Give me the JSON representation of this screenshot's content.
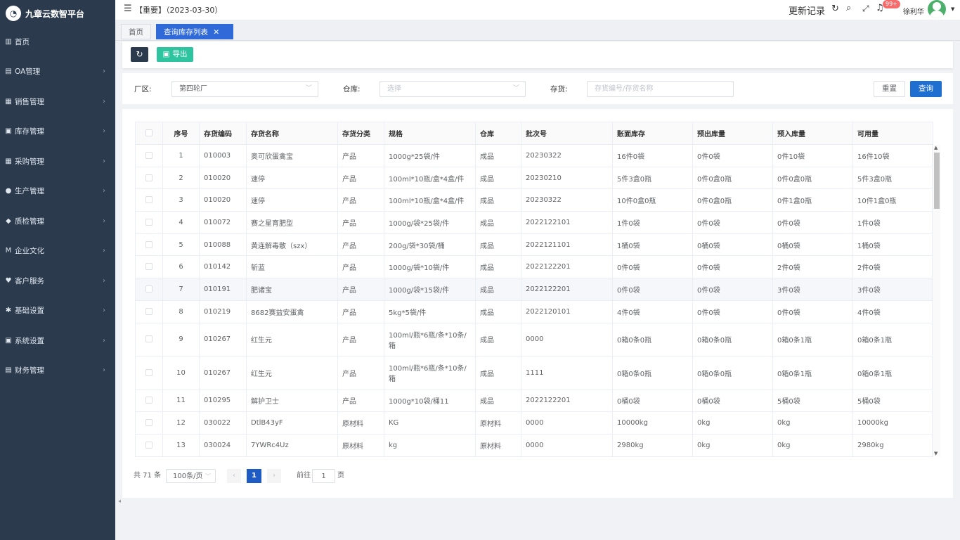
{
  "app": {
    "name": "九章云数智平台"
  },
  "sidebar": {
    "items": [
      {
        "label": "首页",
        "icon": "home-icon",
        "glyph": "▥"
      },
      {
        "label": "OA管理",
        "icon": "oa-icon",
        "glyph": "▤"
      },
      {
        "label": "销售管理",
        "icon": "sales-icon",
        "glyph": "▦"
      },
      {
        "label": "库存管理",
        "icon": "inventory-icon",
        "glyph": "▣"
      },
      {
        "label": "采购管理",
        "icon": "purchase-icon",
        "glyph": "▦"
      },
      {
        "label": "生产管理",
        "icon": "production-icon",
        "glyph": "●"
      },
      {
        "label": "质检管理",
        "icon": "quality-icon",
        "glyph": "◆"
      },
      {
        "label": "企业文化",
        "icon": "culture-icon",
        "glyph": "M"
      },
      {
        "label": "客户服务",
        "icon": "service-icon",
        "glyph": "♥"
      },
      {
        "label": "基础设置",
        "icon": "basic-settings-icon",
        "glyph": "✱"
      },
      {
        "label": "系统设置",
        "icon": "system-settings-icon",
        "glyph": "▣"
      },
      {
        "label": "财务管理",
        "icon": "finance-icon",
        "glyph": "▤"
      }
    ]
  },
  "topbar": {
    "notice": "【重要】（2023-03-30）",
    "update_log": "更新记录",
    "badge": "99+",
    "user": "徐利华"
  },
  "tabs": [
    {
      "label": "首页"
    },
    {
      "label": "查询库存列表"
    }
  ],
  "toolbar": {
    "export_label": "导出"
  },
  "filters": {
    "factory_label": "厂区:",
    "factory_value": "第四轮厂",
    "warehouse_label": "仓库:",
    "warehouse_placeholder": "选择",
    "stock_label": "存货:",
    "stock_placeholder": "存货编号/存货名称",
    "reset_label": "重置",
    "search_label": "查询"
  },
  "table": {
    "headers": [
      "序号",
      "存货编码",
      "存货名称",
      "存货分类",
      "规格",
      "仓库",
      "批次号",
      "账面库存",
      "预出库量",
      "预入库量",
      "可用量"
    ],
    "rows": [
      [
        "1",
        "010003",
        "奥可欣蛋禽宝",
        "产品",
        "1000g*25袋/件",
        "成品",
        "20230322",
        "16件0袋",
        "0件0袋",
        "0件10袋",
        "16件10袋"
      ],
      [
        "2",
        "010020",
        "速停",
        "产品",
        "100ml*10瓶/盒*4盒/件",
        "成品",
        "20230210",
        "5件3盒0瓶",
        "0件0盒0瓶",
        "0件0盒0瓶",
        "5件3盒0瓶"
      ],
      [
        "3",
        "010020",
        "速停",
        "产品",
        "100ml*10瓶/盒*4盒/件",
        "成品",
        "20230322",
        "10件0盒0瓶",
        "0件0盒0瓶",
        "0件1盒0瓶",
        "10件1盒0瓶"
      ],
      [
        "4",
        "010072",
        "赛之星育肥型",
        "产品",
        "1000g/袋*25袋/件",
        "成品",
        "2022122101",
        "1件0袋",
        "0件0袋",
        "0件0袋",
        "1件0袋"
      ],
      [
        "5",
        "010088",
        "黄连解毒散（szx）",
        "产品",
        "200g/袋*30袋/桶",
        "成品",
        "2022121101",
        "1桶0袋",
        "0桶0袋",
        "0桶0袋",
        "1桶0袋"
      ],
      [
        "6",
        "010142",
        "斩蓝",
        "产品",
        "1000g/袋*10袋/件",
        "成品",
        "2022122201",
        "0件0袋",
        "0件0袋",
        "2件0袋",
        "2件0袋"
      ],
      [
        "7",
        "010191",
        "肥诸宝",
        "产品",
        "1000g/袋*15袋/件",
        "成品",
        "2022122201",
        "0件0袋",
        "0件0袋",
        "3件0袋",
        "3件0袋"
      ],
      [
        "8",
        "010219",
        "8682赛益安蛋禽",
        "产品",
        "5kg*5袋/件",
        "成品",
        "2022120101",
        "4件0袋",
        "0件0袋",
        "0件0袋",
        "4件0袋"
      ],
      [
        "9",
        "010267",
        "红生元",
        "产品",
        "100ml/瓶*6瓶/条*10条/箱",
        "成品",
        "0000",
        "0箱0条0瓶",
        "0箱0条0瓶",
        "0箱0条1瓶",
        "0箱0条1瓶"
      ],
      [
        "10",
        "010267",
        "红生元",
        "产品",
        "100ml/瓶*6瓶/条*10条/箱",
        "成品",
        "1111",
        "0箱0条0瓶",
        "0箱0条0瓶",
        "0箱0条1瓶",
        "0箱0条1瓶"
      ],
      [
        "11",
        "010295",
        "解护卫士",
        "产品",
        "1000g*10袋/桶11",
        "成品",
        "2022122201",
        "0桶0袋",
        "0桶0袋",
        "5桶0袋",
        "5桶0袋"
      ],
      [
        "12",
        "030022",
        "DtlB43yF",
        "原材料",
        "KG",
        "原材料",
        "0000",
        "10000kg",
        "0kg",
        "0kg",
        "10000kg"
      ],
      [
        "13",
        "030024",
        "7YWRc4Uz",
        "原材料",
        "kg",
        "原材料",
        "0000",
        "2980kg",
        "0kg",
        "0kg",
        "2980kg"
      ]
    ]
  },
  "pagination": {
    "total": "共 71 条",
    "page_size": "100条/页",
    "current": "1",
    "goto_prefix": "前往",
    "goto_value": "1",
    "goto_suffix": "页"
  }
}
